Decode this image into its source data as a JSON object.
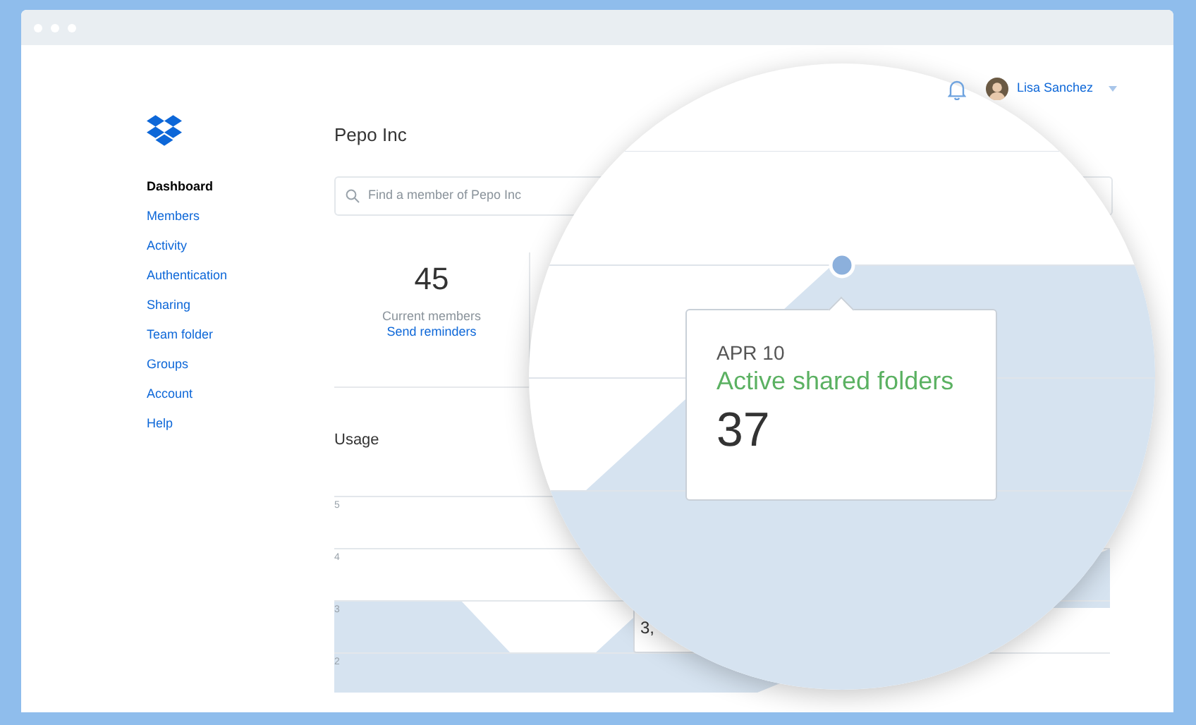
{
  "header": {
    "user_name": "Lisa Sanchez"
  },
  "sidebar": {
    "items": [
      {
        "label": "Dashboard",
        "selected": true
      },
      {
        "label": "Members",
        "selected": false
      },
      {
        "label": "Activity",
        "selected": false
      },
      {
        "label": "Authentication",
        "selected": false
      },
      {
        "label": "Sharing",
        "selected": false
      },
      {
        "label": "Team folder",
        "selected": false
      },
      {
        "label": "Groups",
        "selected": false
      },
      {
        "label": "Account",
        "selected": false
      },
      {
        "label": "Help",
        "selected": false
      }
    ]
  },
  "page_title": "Pepo Inc",
  "search": {
    "placeholder": "Find a member of Pepo Inc"
  },
  "stats": [
    {
      "value": "45",
      "label": "Current members",
      "link": "Send reminders"
    }
  ],
  "usage": {
    "title": "Usage",
    "y_labels": [
      "5",
      "4",
      "3",
      "2"
    ],
    "tooltip_fragment": "3,"
  },
  "magnifier": {
    "tooltip": {
      "date": "APR 10",
      "metric": "Active shared folders",
      "value": "37"
    }
  }
}
